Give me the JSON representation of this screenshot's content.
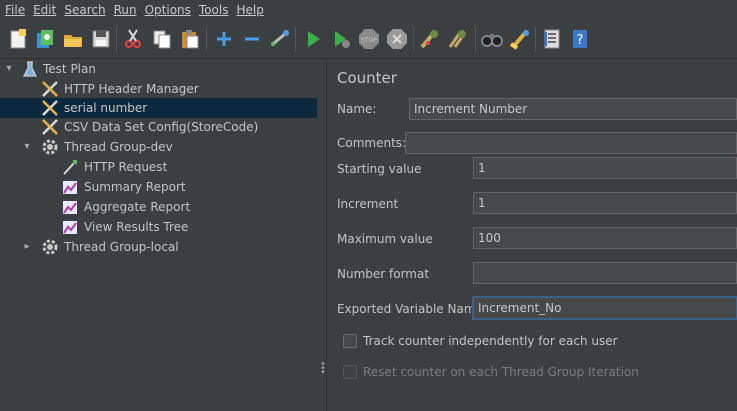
{
  "menu": [
    "File",
    "Edit",
    "Search",
    "Run",
    "Options",
    "Tools",
    "Help"
  ],
  "toolbar": {
    "icons": [
      "new-icon",
      "templates-icon",
      "open-icon",
      "save-icon",
      "cut-icon",
      "copy-icon",
      "paste-icon",
      "expand-icon",
      "collapse-icon",
      "toggle-icon",
      "start-icon",
      "start-no-pauses-icon",
      "stop-icon",
      "shutdown-icon",
      "clear-icon",
      "clear-all-icon",
      "search-icon",
      "reset-search-icon",
      "function-helper-icon",
      "help-icon"
    ]
  },
  "tree": {
    "items": [
      {
        "label": "Test Plan",
        "icon": "test-plan-icon",
        "expanded": true
      },
      {
        "label": "HTTP Header Manager",
        "icon": "config-element-icon"
      },
      {
        "label": "serial number",
        "icon": "config-element-icon",
        "selected": true
      },
      {
        "label": "CSV Data Set Config(StoreCode)",
        "icon": "config-element-icon"
      },
      {
        "label": "Thread Group-dev",
        "icon": "thread-group-icon",
        "expanded": true
      },
      {
        "label": "HTTP Request",
        "icon": "sampler-icon"
      },
      {
        "label": "Summary Report",
        "icon": "listener-icon"
      },
      {
        "label": "Aggregate Report",
        "icon": "listener-icon"
      },
      {
        "label": "View Results Tree",
        "icon": "listener-icon"
      },
      {
        "label": "Thread Group-local",
        "icon": "thread-group-icon",
        "expanded": false
      }
    ]
  },
  "panel": {
    "title": "Counter",
    "name_label": "Name:",
    "name_value": "Increment Number",
    "comments_label": "Comments:",
    "comments_value": "",
    "start_label": "Starting value",
    "start_value": "1",
    "increment_label": "Increment",
    "increment_value": "1",
    "max_label": "Maximum value",
    "max_value": "100",
    "format_label": "Number format",
    "format_value": "",
    "export_label": "Exported Variable Name",
    "export_value": "Increment_No",
    "track_label": "Track counter independently for each user",
    "reset_label": "Reset counter on each Thread Group Iteration"
  }
}
